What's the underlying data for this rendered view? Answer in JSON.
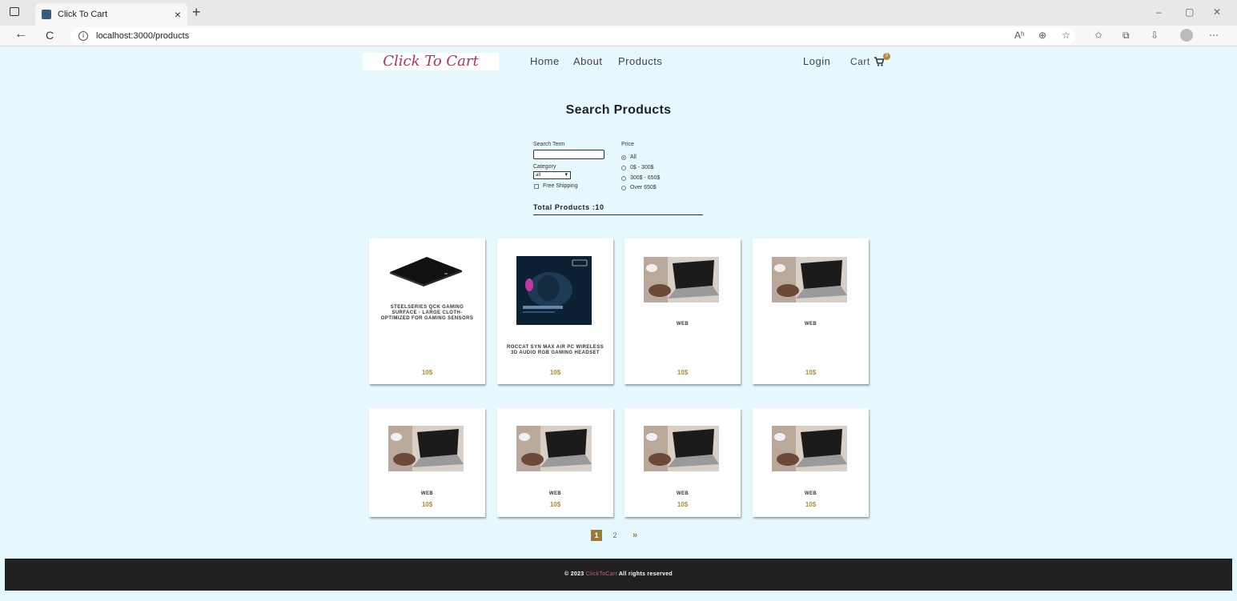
{
  "browser": {
    "tab_title": "Click To Cart",
    "tab_close": "×",
    "new_tab": "+",
    "url": "localhost:3000/products",
    "back": "←",
    "reload": "C",
    "info": "i",
    "window_controls": [
      "–",
      "▢",
      "✕"
    ],
    "toolbar_icons": [
      "Aʰ",
      "⊕",
      "☆",
      "✩",
      "⧉",
      "⇩",
      "⋯"
    ]
  },
  "site": {
    "logo": "Click To Cart",
    "nav": {
      "home": "Home",
      "about": "About",
      "products": "Products",
      "login": "Login",
      "cart": "Cart",
      "cart_count": "0"
    }
  },
  "filters": {
    "title": "Search Products",
    "search_label": "Search Term",
    "search_value": "",
    "category_label": "Category",
    "category_value": "all",
    "free_shipping_label": "Free Shipping",
    "price_label": "Price",
    "price_options": [
      "All",
      "0$ - 300$",
      "300$ - 650$",
      "Over 650$"
    ],
    "price_selected": "All",
    "total_products": "Total Products :10"
  },
  "products": [
    {
      "title": "STEELSERIES QCK GAMING SURFACE - LARGE CLOTH- OPTIMIZED FOR GAMING SENSORS",
      "price": "10$",
      "image": "mousepad"
    },
    {
      "title": "ROCCAT SYN MAX AIR PC WIRELESS 3D AUDIO RGB GAMING HEADSET",
      "price": "10$",
      "image": "headset"
    },
    {
      "title": "WEB",
      "price": "10$",
      "image": "laptop"
    },
    {
      "title": "WEB",
      "price": "10$",
      "image": "laptop"
    },
    {
      "title": "WEB",
      "price": "10$",
      "image": "laptop"
    },
    {
      "title": "WEB",
      "price": "10$",
      "image": "laptop"
    },
    {
      "title": "WEB",
      "price": "10$",
      "image": "laptop"
    },
    {
      "title": "WEB",
      "price": "10$",
      "image": "laptop"
    }
  ],
  "pagination": {
    "page1": "1",
    "page2": "2",
    "next": "»"
  },
  "footer": {
    "prefix": "© 2023",
    "brand": "ClickToCart",
    "suffix": "All rights reserved"
  },
  "colors": {
    "background": "#e6f7fd",
    "accent": "#b58a3a",
    "logo": "#b03060",
    "footer": "#212121"
  }
}
